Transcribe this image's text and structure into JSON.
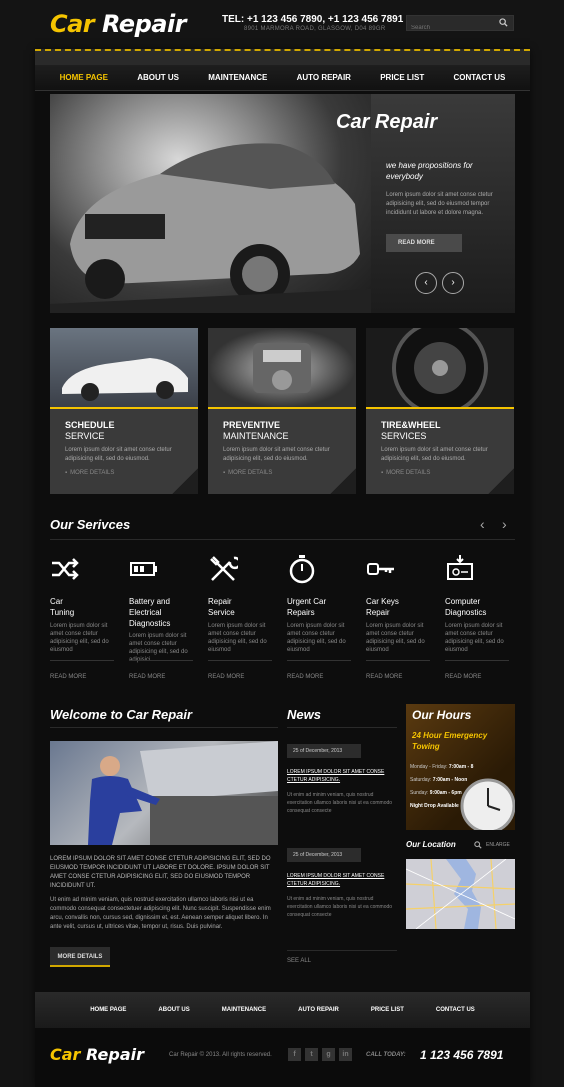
{
  "header": {
    "logo_part1": "Car",
    "logo_part2": "Repair",
    "tel": "TEL: +1 123 456 7890, +1 123 456 7891",
    "address": "8901 MARMORA ROAD, GLASGOW, D04 89GR",
    "search_placeholder": "Search"
  },
  "nav": [
    {
      "label": "HOME PAGE",
      "active": true
    },
    {
      "label": "ABOUT US"
    },
    {
      "label": "MAINTENANCE"
    },
    {
      "label": "AUTO REPAIR"
    },
    {
      "label": "PRICE LIST"
    },
    {
      "label": "CONTACT US"
    }
  ],
  "hero": {
    "title": "Car Repair",
    "subtitle": "we have propositions for everybody",
    "text": "Lorem ipsum dolor sit amet conse ctetur adipisicing elit, sed do eiusmod tempor incididunt ut labore et dolore magna.",
    "button": "READ MORE",
    "prev": "‹",
    "next": "›"
  },
  "features": [
    {
      "title_bold": "SCHEDULE",
      "title_rest": "SERVICE",
      "text": "Lorem ipsum dolor sit amet conse ctetur adipisicing elit, sed do eiusmod.",
      "more": "MORE DETAILS"
    },
    {
      "title_bold": "PREVENTIVE",
      "title_rest": "MAINTENANCE",
      "text": "Lorem ipsum dolor sit amet conse ctetur adipisicing elit, sed do eiusmod.",
      "more": "MORE DETAILS"
    },
    {
      "title_bold": "TIRE&WHEEL",
      "title_rest": "SERVICES",
      "text": "Lorem ipsum dolor sit amet conse ctetur adipisicing elit, sed do eiusmod.",
      "more": "MORE DETAILS"
    }
  ],
  "services": {
    "title": "Our Serivces",
    "prev": "‹",
    "next": "›",
    "items": [
      {
        "name": "Car Tuning",
        "text": "Lorem ipsum dolor sit amet conse ctetur adipisicing elit, sed do eiusmod",
        "more": "READ MORE",
        "icon": "shuffle-icon"
      },
      {
        "name": "Battery and Electrical Diagnostics",
        "text": "Lorem ipsum dolor sit amet conse ctetur adipisicing elit, sed do adipisici",
        "more": "READ MORE",
        "icon": "battery-icon"
      },
      {
        "name": "Repair Service",
        "text": "Lorem ipsum dolor sit amet conse ctetur adipisicing elit, sed do eiusmod",
        "more": "READ MORE",
        "icon": "tools-icon"
      },
      {
        "name": "Urgent Car Repairs",
        "text": "Lorem ipsum dolor sit amet conse ctetur adipisicing elit, sed do eiusmod",
        "more": "READ MORE",
        "icon": "stopwatch-icon"
      },
      {
        "name": "Car Keys Repair",
        "text": "Lorem ipsum dolor sit amet conse ctetur adipisicing elit, sed do eiusmod",
        "more": "READ MORE",
        "icon": "key-icon"
      },
      {
        "name": "Computer Diagnostics",
        "text": "Lorem ipsum dolor sit amet conse ctetur adipisicing elit, sed do eiusmod",
        "more": "READ MORE",
        "icon": "computer-icon"
      }
    ]
  },
  "welcome": {
    "title": "Welcome to Car Repair",
    "lead": "LOREM IPSUM DOLOR SIT AMET CONSE CTETUR ADIPISICING ELIT, SED DO EIUSMOD TEMPOR INCIDIDUNT UT LABORE ET DOLORE. IPSUM DOLOR SIT AMET CONSE CTETUR ADIPISICING ELIT, SED DO EIUSMOD TEMPOR INCIDIDUNT UT.",
    "text": "Ut enim ad minim veniam, quis nostrud exercitation ullamco laboris nisi ut ea commodo consequat consectetuer adipiscing elit. Nunc suscipit. Suspendisse enim arcu, convallis non, cursus sed, dignissim et, est. Aenean semper aliquet libero. In ante velit, cursus ut, ultrices vitae, tempor ut, risus. Duis pulvinar.",
    "button": "MORE DETAILS"
  },
  "news": {
    "title": "News",
    "items": [
      {
        "date": "25 of December, 2013",
        "link": "LOREM IPSUM DOLOR SIT AMET CONSE CTETUR ADIPISICING.",
        "text": "Ut enim ad minim veniam, quis nostrud exercitation ullamco laboris nisi ut ea commodo consequat consecte"
      },
      {
        "date": "25 of December, 2013",
        "link": "LOREM IPSUM DOLOR SIT AMET CONSE CTETUR ADIPISICING.",
        "text": "Ut enim ad minim veniam, quis nostrud exercitation ullamco laboris nisi ut ea commodo consequat consecte"
      }
    ],
    "see_all": "SEE ALL"
  },
  "hours": {
    "title": "Our Hours",
    "subtitle": "24 Hour Emergency Towing",
    "rows": [
      {
        "day": "Monday - Friday:",
        "time": "7:00am - 8"
      },
      {
        "day": "Saturday:",
        "time": "7:00am - Noon"
      },
      {
        "day": "Sunday:",
        "time": "9:00am - 6pm"
      }
    ],
    "night": "Night Drop Available"
  },
  "location": {
    "title": "Our Location",
    "enlarge": "ENLARGE"
  },
  "footer_nav": [
    "HOME PAGE",
    "ABOUT US",
    "MAINTENANCE",
    "AUTO REPAIR",
    "PRICE LIST",
    "CONTACT US"
  ],
  "footer": {
    "logo_part1": "Car",
    "logo_part2": "Repair",
    "copyright": "Car Repair © 2013. All rights reserved.",
    "social": [
      "f",
      "t",
      "g",
      "in"
    ],
    "call_label": "CALL TODAY:",
    "phone": "1 123 456 7891"
  },
  "colors": {
    "accent": "#f5c400",
    "background": "#0d0d0d"
  }
}
